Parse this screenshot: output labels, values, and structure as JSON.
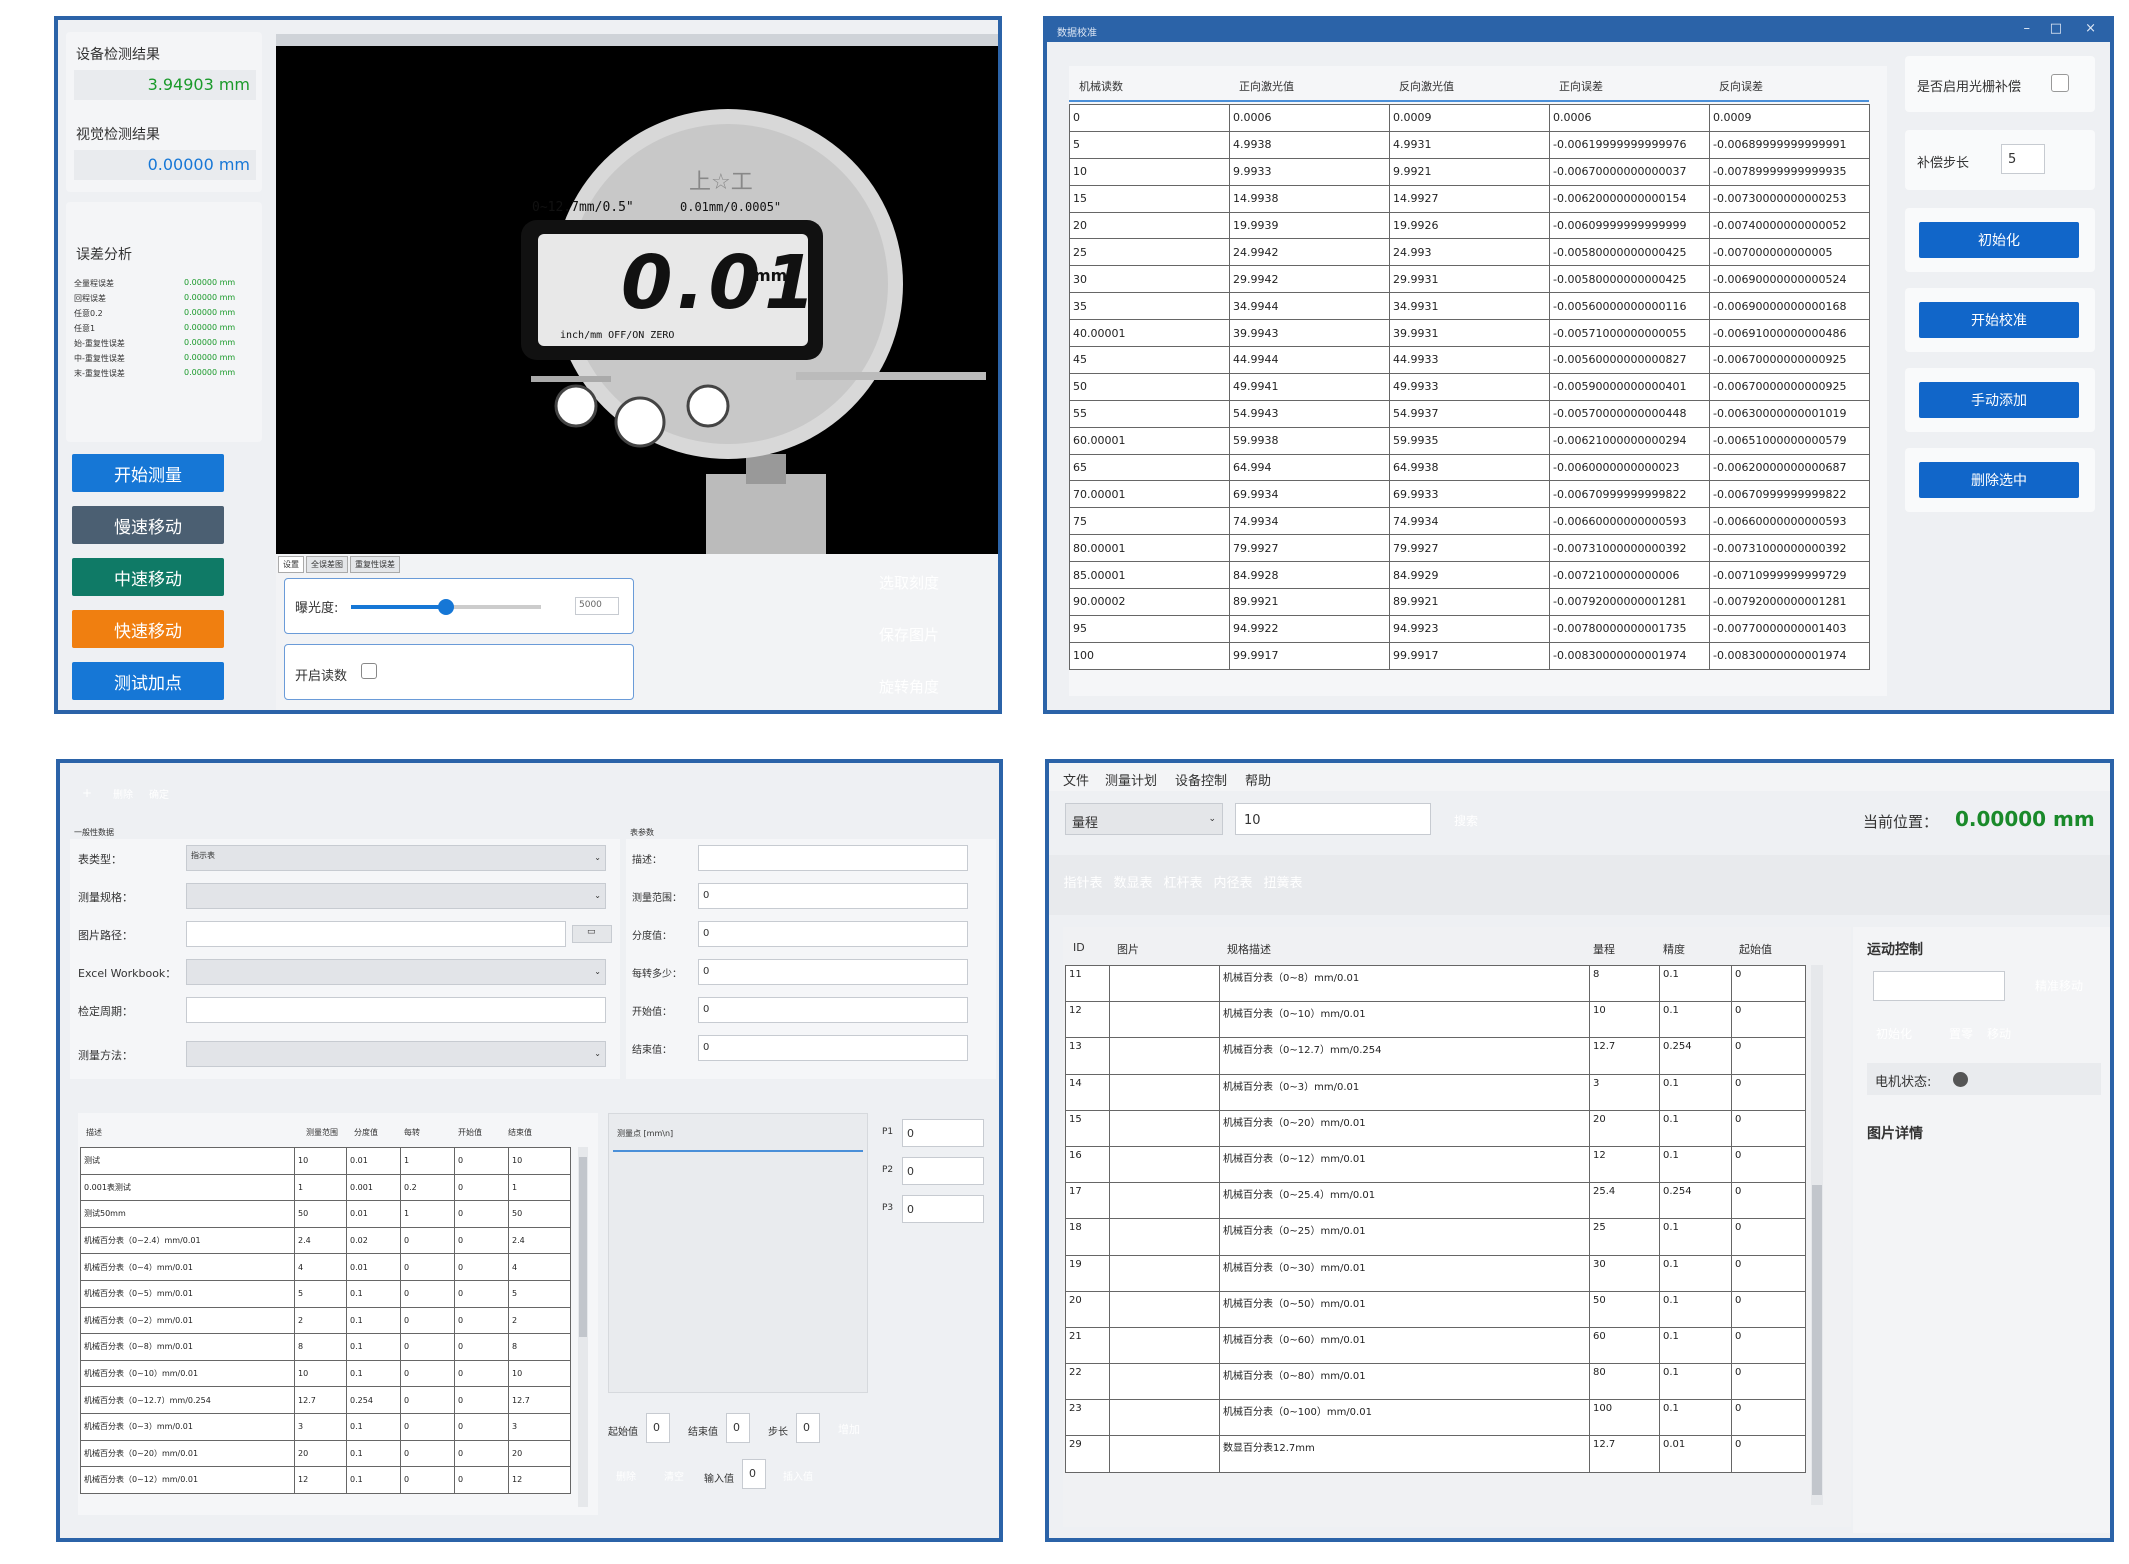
{
  "p1": {
    "device_result_label": "设备检测结果",
    "device_result_value": "3.94903 mm",
    "vision_result_label": "视觉检测结果",
    "vision_result_value": "0.00000 mm",
    "error_title": "误差分析",
    "errors": [
      {
        "label": "全量程误差",
        "value": "0.00000 mm"
      },
      {
        "label": "回程误差",
        "value": "0.00000 mm"
      },
      {
        "label": "任意0.2",
        "value": "0.00000 mm"
      },
      {
        "label": "任意1",
        "value": "0.00000 mm"
      },
      {
        "label": "始-重复性误差",
        "value": "0.00000 mm"
      },
      {
        "label": "中-重复性误差",
        "value": "0.00000 mm"
      },
      {
        "label": "末-重复性误差",
        "value": "0.00000 mm"
      }
    ],
    "buttons": [
      "开始测量",
      "慢速移动",
      "中速移动",
      "快速移动",
      "测试加点"
    ],
    "gauge": {
      "brand": "上☆工",
      "range": "0~12.7mm/0.5\"",
      "resolution": "0.01mm/0.0005\"",
      "reading": "0.01",
      "unit": "mm",
      "sub_labels": "inch/mm   OFF/ON   ZERO"
    },
    "tabs": [
      "设置",
      "全误差图",
      "重复性误差"
    ],
    "exposure_label": "曝光度:",
    "exposure_value": "5000",
    "exposure_level": 0.5,
    "reading_toggle_label": "开启读数",
    "side_buttons": [
      "选取刻度",
      "保存图片",
      "旋转角度"
    ]
  },
  "p2": {
    "title": "数据校准",
    "columns": [
      "机械读数",
      "正向激光值",
      "反向激光值",
      "正向误差",
      "反向误差"
    ],
    "rows": [
      [
        "0",
        "0.0006",
        "0.0009",
        "0.0006",
        "0.0009"
      ],
      [
        "5",
        "4.9938",
        "4.9931",
        "-0.00619999999999976",
        "-0.00689999999999991"
      ],
      [
        "10",
        "9.9933",
        "9.9921",
        "-0.00670000000000037",
        "-0.00789999999999935"
      ],
      [
        "15",
        "14.9938",
        "14.9927",
        "-0.00620000000000154",
        "-0.00730000000000253"
      ],
      [
        "20",
        "19.9939",
        "19.9926",
        "-0.00609999999999999",
        "-0.00740000000000052"
      ],
      [
        "25",
        "24.9942",
        "24.993",
        "-0.00580000000000425",
        "-0.007000000000005"
      ],
      [
        "30",
        "29.9942",
        "29.9931",
        "-0.00580000000000425",
        "-0.00690000000000524"
      ],
      [
        "35",
        "34.9944",
        "34.9931",
        "-0.00560000000000116",
        "-0.00690000000000168"
      ],
      [
        "40.00001",
        "39.9943",
        "39.9931",
        "-0.00571000000000055",
        "-0.00691000000000486"
      ],
      [
        "45",
        "44.9944",
        "44.9933",
        "-0.00560000000000827",
        "-0.00670000000000925"
      ],
      [
        "50",
        "49.9941",
        "49.9933",
        "-0.00590000000000401",
        "-0.00670000000000925"
      ],
      [
        "55",
        "54.9943",
        "54.9937",
        "-0.00570000000000448",
        "-0.00630000000001019"
      ],
      [
        "60.00001",
        "59.9938",
        "59.9935",
        "-0.00621000000000294",
        "-0.00651000000000579"
      ],
      [
        "65",
        "64.994",
        "64.9938",
        "-0.0060000000000023",
        "-0.00620000000000687"
      ],
      [
        "70.00001",
        "69.9934",
        "69.9933",
        "-0.00670999999999822",
        "-0.00670999999999822"
      ],
      [
        "75",
        "74.9934",
        "74.9934",
        "-0.00660000000000593",
        "-0.00660000000000593"
      ],
      [
        "80.00001",
        "79.9927",
        "79.9927",
        "-0.00731000000000392",
        "-0.00731000000000392"
      ],
      [
        "85.00001",
        "84.9928",
        "84.9929",
        "-0.0072100000000006",
        "-0.00710999999999729"
      ],
      [
        "90.00002",
        "89.9921",
        "89.9921",
        "-0.00792000000001281",
        "-0.00792000000001281"
      ],
      [
        "95",
        "94.9922",
        "94.9923",
        "-0.00780000000001735",
        "-0.00770000000001403"
      ],
      [
        "100",
        "99.9917",
        "99.9917",
        "-0.00830000000001974",
        "-0.00830000000001974"
      ]
    ],
    "grating_label": "是否启用光栅补偿",
    "step_label": "补偿步长",
    "step_value": "5",
    "buttons": [
      "初始化",
      "开始校准",
      "手动添加",
      "删除选中"
    ]
  },
  "p3": {
    "toolbar": [
      "+",
      "删除",
      "确定"
    ],
    "general_title": "一般性数据",
    "form_labels": [
      "表类型：",
      "测量规格：",
      "图片路径：",
      "Excel Workbook：",
      "检定周期：",
      "测量方法："
    ],
    "type_value": "指示表",
    "table_title": "表参数",
    "param_labels": [
      "描述：",
      "测量范围：",
      "分度值：",
      "每转多少：",
      "开始值：",
      "结束值："
    ],
    "param_values": [
      "",
      "0",
      "0",
      "0",
      "0",
      "0"
    ],
    "columns": [
      "描述",
      "测量范围",
      "分度值",
      "每转",
      "开始值",
      "结束值"
    ],
    "rows": [
      [
        "测试",
        "10",
        "0.01",
        "1",
        "0",
        "10"
      ],
      [
        "0.001表测试",
        "1",
        "0.001",
        "0.2",
        "0",
        "1"
      ],
      [
        "测试50mm",
        "50",
        "0.01",
        "1",
        "0",
        "50"
      ],
      [
        "机械百分表（0~2.4）mm/0.01",
        "2.4",
        "0.02",
        "0",
        "0",
        "2.4"
      ],
      [
        "机械百分表（0~4）mm/0.01",
        "4",
        "0.01",
        "0",
        "0",
        "4"
      ],
      [
        "机械百分表（0~5）mm/0.01",
        "5",
        "0.1",
        "0",
        "0",
        "5"
      ],
      [
        "机械百分表（0~2）mm/0.01",
        "2",
        "0.1",
        "0",
        "0",
        "2"
      ],
      [
        "机械百分表（0~8）mm/0.01",
        "8",
        "0.1",
        "0",
        "0",
        "8"
      ],
      [
        "机械百分表（0~10）mm/0.01",
        "10",
        "0.1",
        "0",
        "0",
        "10"
      ],
      [
        "机械百分表（0~12.7）mm/0.254",
        "12.7",
        "0.254",
        "0",
        "0",
        "12.7"
      ],
      [
        "机械百分表（0~3）mm/0.01",
        "3",
        "0.1",
        "0",
        "0",
        "3"
      ],
      [
        "机械百分表（0~20）mm/0.01",
        "20",
        "0.1",
        "0",
        "0",
        "20"
      ],
      [
        "机械百分表（0~12）mm/0.01",
        "12",
        "0.1",
        "0",
        "0",
        "12"
      ]
    ],
    "points_header": "测量点 [mm\\n]",
    "p_labels": [
      "P1",
      "P2",
      "P3"
    ],
    "p_values": [
      "0",
      "0",
      "0"
    ],
    "start_label": "起始值",
    "start_value": "0",
    "end_label": "结束值",
    "end_value": "0",
    "step_label": "步长",
    "step_value": "0",
    "add_button": "增加",
    "delete_button": "删除",
    "clear_button": "清空",
    "input_label": "输入值",
    "input_value": "0",
    "insert_button": "插入值"
  },
  "p4": {
    "menu": [
      "文件",
      "测量计划",
      "设备控制",
      "帮助"
    ],
    "filter_select": "量程",
    "filter_value": "10",
    "search_button": "搜索",
    "position_label": "当前位置：",
    "position_value": "0.00000 mm",
    "type_buttons": [
      "指针表",
      "数显表",
      "杠杆表",
      "内径表",
      "扭簧表"
    ],
    "columns": [
      "ID",
      "图片",
      "规格描述",
      "量程",
      "精度",
      "起始值"
    ],
    "rows": [
      [
        "11",
        "",
        "机械百分表（0~8）mm/0.01",
        "8",
        "0.1",
        "0"
      ],
      [
        "12",
        "",
        "机械百分表（0~10）mm/0.01",
        "10",
        "0.1",
        "0"
      ],
      [
        "13",
        "",
        "机械百分表（0~12.7）mm/0.254",
        "12.7",
        "0.254",
        "0"
      ],
      [
        "14",
        "",
        "机械百分表（0~3）mm/0.01",
        "3",
        "0.1",
        "0"
      ],
      [
        "15",
        "",
        "机械百分表（0~20）mm/0.01",
        "20",
        "0.1",
        "0"
      ],
      [
        "16",
        "",
        "机械百分表（0~12）mm/0.01",
        "12",
        "0.1",
        "0"
      ],
      [
        "17",
        "",
        "机械百分表（0~25.4）mm/0.01",
        "25.4",
        "0.254",
        "0"
      ],
      [
        "18",
        "",
        "机械百分表（0~25）mm/0.01",
        "25",
        "0.1",
        "0"
      ],
      [
        "19",
        "",
        "机械百分表（0~30）mm/0.01",
        "30",
        "0.1",
        "0"
      ],
      [
        "20",
        "",
        "机械百分表（0~50）mm/0.01",
        "50",
        "0.1",
        "0"
      ],
      [
        "21",
        "",
        "机械百分表（0~60）mm/0.01",
        "60",
        "0.1",
        "0"
      ],
      [
        "22",
        "",
        "机械百分表（0~80）mm/0.01",
        "80",
        "0.1",
        "0"
      ],
      [
        "23",
        "",
        "机械百分表（0~100）mm/0.01",
        "100",
        "0.1",
        "0"
      ],
      [
        "29",
        "",
        "数显百分表12.7mm",
        "12.7",
        "0.01",
        "0"
      ]
    ],
    "motion_title": "运动控制",
    "precise_button": "精准移动",
    "init_button": "初始化",
    "zero_button": "置零",
    "move_button": "移动",
    "motor_label": "电机状态:",
    "image_detail_title": "图片详情"
  },
  "colors": {
    "accent": "#1677d6",
    "frame": "#2b63a8",
    "green_value": "#1a9a2a"
  }
}
